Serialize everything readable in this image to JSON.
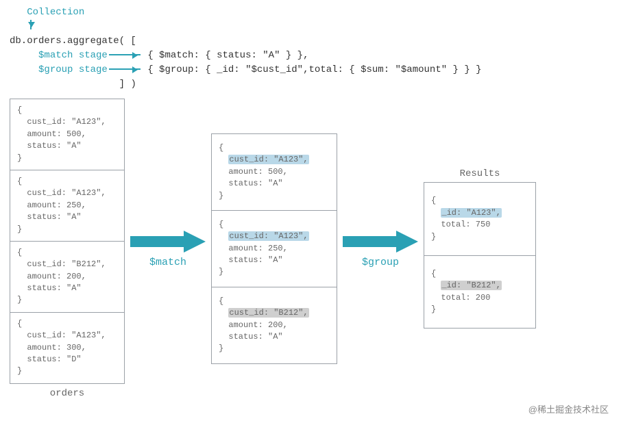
{
  "header": {
    "collection_label": "Collection",
    "aggregate_call": "db.orders.aggregate( [",
    "match_stage_label": "$match stage",
    "group_stage_label": "$group stage",
    "match_stage_code": "{ $match: { status: \"A\" } },",
    "group_stage_code": "{ $group: { _id: \"$cust_id\",total: { $sum: \"$amount\" } } }",
    "close": "] )"
  },
  "stage1_label": "$match",
  "stage2_label": "$group",
  "orders_caption": "orders",
  "results_caption": "Results",
  "orders": [
    {
      "cust_id": "A123",
      "amount": 500,
      "status": "A"
    },
    {
      "cust_id": "A123",
      "amount": 250,
      "status": "A"
    },
    {
      "cust_id": "B212",
      "amount": 200,
      "status": "A"
    },
    {
      "cust_id": "A123",
      "amount": 300,
      "status": "D"
    }
  ],
  "matched": [
    {
      "cust_id": "A123",
      "amount": 500,
      "status": "A",
      "hl": "blue"
    },
    {
      "cust_id": "A123",
      "amount": 250,
      "status": "A",
      "hl": "blue"
    },
    {
      "cust_id": "B212",
      "amount": 200,
      "status": "A",
      "hl": "grey"
    }
  ],
  "results": [
    {
      "_id": "A123",
      "total": 750,
      "hl": "blue"
    },
    {
      "_id": "B212",
      "total": 200,
      "hl": "grey"
    }
  ],
  "watermark": "@稀土掘金技术社区"
}
